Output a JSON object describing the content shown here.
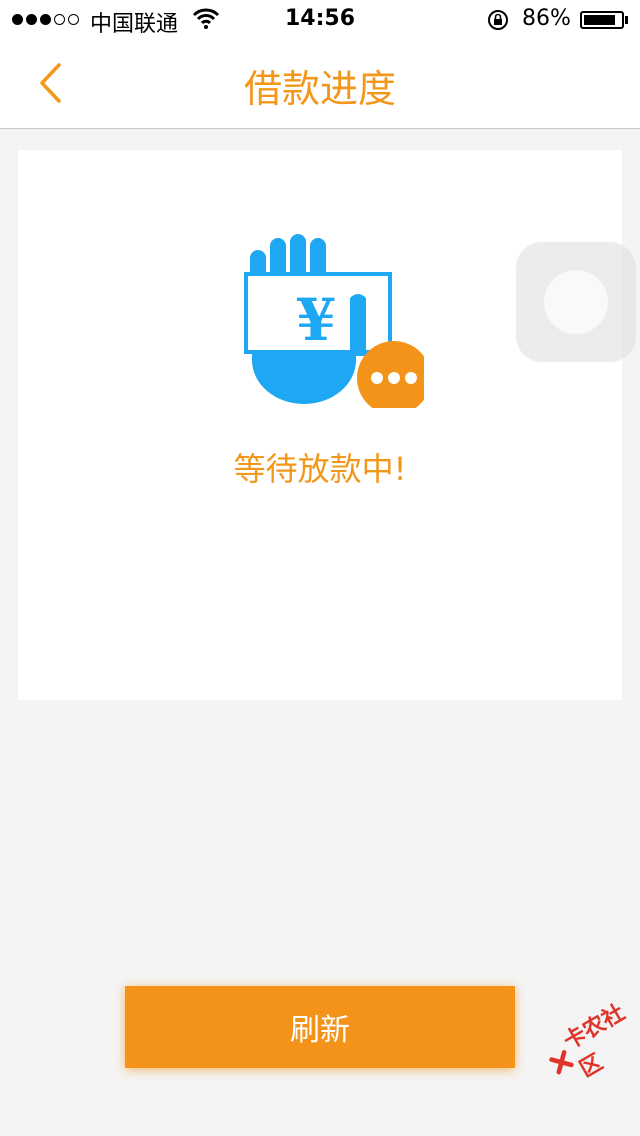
{
  "status_bar": {
    "carrier": "中国联通",
    "time": "14:56",
    "battery": "86%",
    "battery_level": 0.86
  },
  "nav": {
    "title": "借款进度",
    "accent_color": "#f3971b"
  },
  "status": {
    "text": "等待放款中!",
    "icon": "hand-money-waiting-icon"
  },
  "refresh_button": {
    "label": "刷新"
  },
  "watermark": {
    "text": "卡农社区"
  }
}
